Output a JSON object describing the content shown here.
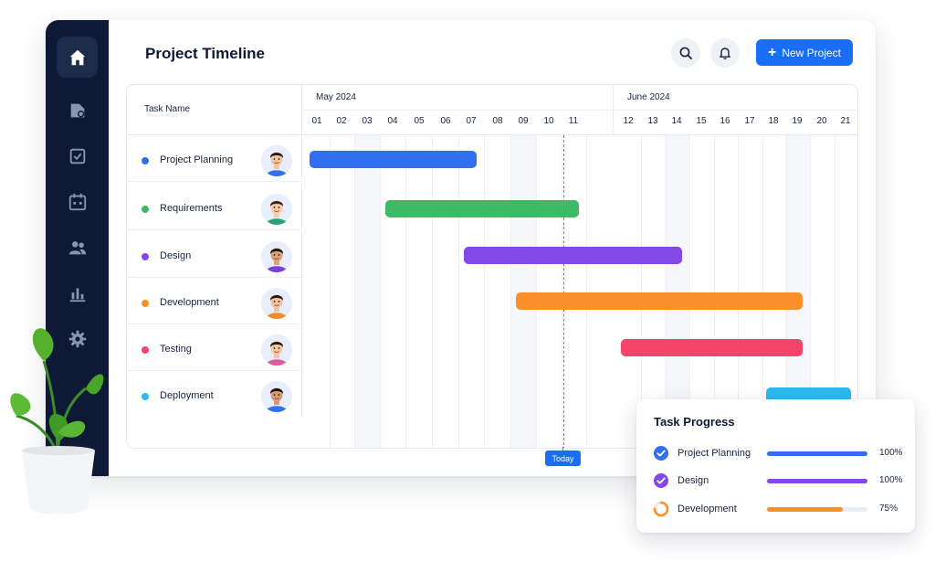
{
  "app": {
    "title": "Project Timeline"
  },
  "header": {
    "new_project_label": "New Project"
  },
  "sidebar": {
    "items": [
      {
        "icon": "home-icon",
        "active": true
      },
      {
        "icon": "folder-icon",
        "active": false
      },
      {
        "icon": "checklist-icon",
        "active": false
      },
      {
        "icon": "calendar-icon",
        "active": false
      },
      {
        "icon": "users-icon",
        "active": false
      },
      {
        "icon": "bar-chart-icon",
        "active": false
      },
      {
        "icon": "gear-icon",
        "active": false
      }
    ]
  },
  "gantt": {
    "task_header": "Task Name",
    "months": [
      {
        "label": "May 2024"
      },
      {
        "label": "June 2024"
      }
    ],
    "days": [
      "01",
      "02",
      "03",
      "04",
      "05",
      "06",
      "07",
      "08",
      "09",
      "10",
      "11",
      "12",
      "13",
      "14",
      "15",
      "16",
      "17",
      "18",
      "19",
      "20",
      "21"
    ],
    "today_label": "Today",
    "tasks": [
      {
        "name": "Project Planning",
        "color": "#2f6ff0",
        "start_day": "01",
        "end_day": "07"
      },
      {
        "name": "Requirements",
        "color": "#3dba66",
        "start_day": "04",
        "end_day": "11"
      },
      {
        "name": "Design",
        "color": "#8448e8",
        "start_day": "07",
        "end_day": "14"
      },
      {
        "name": "Development",
        "color": "#fb8f2a",
        "start_day": "09",
        "end_day": "19"
      },
      {
        "name": "Testing",
        "color": "#f5446a",
        "start_day": "12",
        "end_day": "19"
      },
      {
        "name": "Deployment",
        "color": "#2cb9ef",
        "start_day": "18",
        "end_day": "21"
      }
    ]
  },
  "progress": {
    "title": "Task Progress",
    "items": [
      {
        "label": "Project Planning",
        "pct_label": "100%",
        "value": 1.0,
        "color": "#2f6ff0",
        "status": "complete"
      },
      {
        "label": "Design",
        "pct_label": "100%",
        "value": 1.0,
        "color": "#8448e8",
        "status": "complete"
      },
      {
        "label": "Development",
        "pct_label": "75%",
        "value": 0.75,
        "color": "#fb8f2a",
        "status": "in-progress"
      }
    ]
  }
}
